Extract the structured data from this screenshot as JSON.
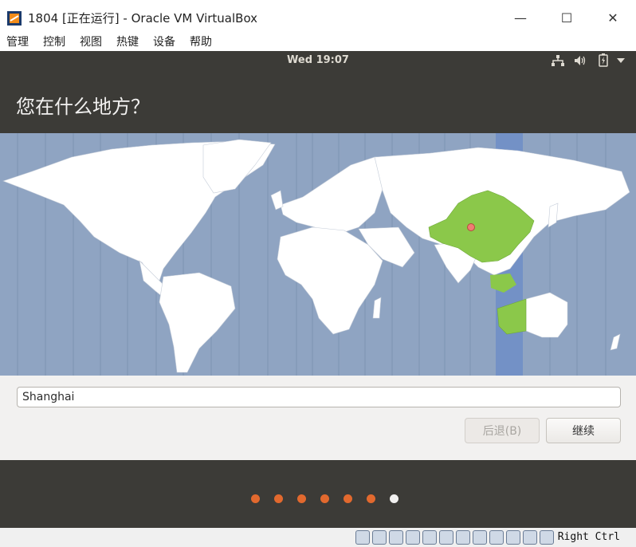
{
  "window": {
    "title": "1804 [正在运行] - Oracle VM VirtualBox",
    "minimize_glyph": "—",
    "maximize_glyph": "☐",
    "close_glyph": "✕"
  },
  "menubar": {
    "items": [
      "管理",
      "控制",
      "视图",
      "热键",
      "设备",
      "帮助"
    ]
  },
  "panel": {
    "clock": "Wed 19:07",
    "tray_icons": [
      "network-icon",
      "volume-icon",
      "battery-icon",
      "system-menu-icon"
    ]
  },
  "installer": {
    "title": "您在什么地方？",
    "timezone_value": "Shanghai",
    "back_label": "后退(B)",
    "continue_label": "继续",
    "progress": {
      "total_steps": 7,
      "current_step": 7
    }
  },
  "colors": {
    "ocean": "#8fa4c2",
    "land": "#ffffff",
    "selected_region": "#8bc84a",
    "selected_timezone_band": "#7391c6",
    "accent": "#e2692e",
    "panel_dark": "#3c3b37"
  },
  "statusbar": {
    "host_key": "Right Ctrl",
    "icons": [
      "hard-disk-icon",
      "optical-drive-icon",
      "audio-icon",
      "network-icon",
      "usb-icon",
      "shared-folders-icon",
      "display-icon",
      "capture-icon",
      "recording-icon",
      "cpu-icon",
      "mouse-integration-icon",
      "keyboard-icon"
    ]
  }
}
